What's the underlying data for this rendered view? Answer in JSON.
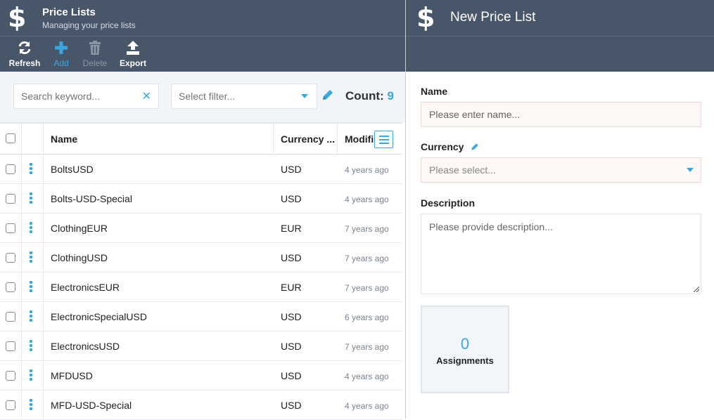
{
  "left_header": {
    "title": "Price Lists",
    "subtitle": "Managing your price lists",
    "logo": "$"
  },
  "toolbar": {
    "refresh": {
      "label": "Refresh",
      "icon": "refresh-icon"
    },
    "add": {
      "label": "Add",
      "icon": "plus-icon"
    },
    "delete": {
      "label": "Delete",
      "icon": "trash-icon"
    },
    "export": {
      "label": "Export",
      "icon": "upload-icon"
    }
  },
  "filters": {
    "search_placeholder": "Search keyword...",
    "filter_placeholder": "Select filter...",
    "count_label": "Count:",
    "count_value": "9"
  },
  "grid": {
    "columns": {
      "name": "Name",
      "currency": "Currency ...",
      "modified": "Modifi..."
    },
    "rows": [
      {
        "name": "BoltsUSD",
        "currency": "USD",
        "modified": "4 years ago"
      },
      {
        "name": "Bolts-USD-Special",
        "currency": "USD",
        "modified": "4 years ago"
      },
      {
        "name": "ClothingEUR",
        "currency": "EUR",
        "modified": "7 years ago"
      },
      {
        "name": "ClothingUSD",
        "currency": "USD",
        "modified": "7 years ago"
      },
      {
        "name": "ElectronicsEUR",
        "currency": "EUR",
        "modified": "7 years ago"
      },
      {
        "name": "ElectronicSpecialUSD",
        "currency": "USD",
        "modified": "6 years ago"
      },
      {
        "name": "ElectronicsUSD",
        "currency": "USD",
        "modified": "7 years ago"
      },
      {
        "name": "MFDUSD",
        "currency": "USD",
        "modified": "4 years ago"
      },
      {
        "name": "MFD-USD-Special",
        "currency": "USD",
        "modified": "4 years ago"
      }
    ]
  },
  "form": {
    "title": "New Price List",
    "logo": "$",
    "name_label": "Name",
    "name_placeholder": "Please enter name...",
    "currency_label": "Currency",
    "currency_placeholder": "Please select...",
    "description_label": "Description",
    "description_placeholder": "Please provide description...",
    "assignments_count": "0",
    "assignments_label": "Assignments"
  },
  "colors": {
    "header_bg": "#475669",
    "accent": "#3aa8e0",
    "filter_bg": "#f1f4f8",
    "required_bg": "#fdf7f6"
  }
}
